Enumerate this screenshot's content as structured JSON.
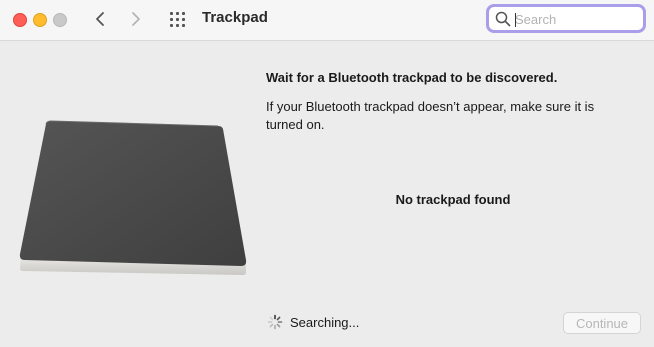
{
  "window": {
    "title": "Trackpad"
  },
  "toolbar": {
    "back_icon": "chevron-left-icon",
    "forward_icon": "chevron-right-icon",
    "grid_icon": "grid-icon"
  },
  "search": {
    "placeholder": "Search",
    "value": ""
  },
  "main": {
    "heading": "Wait for a Bluetooth trackpad to be discovered.",
    "description": "If your Bluetooth trackpad doesn’t appear, make sure it is turned on.",
    "status": "No trackpad found",
    "searching_label": "Searching...",
    "continue_label": "Continue"
  },
  "colors": {
    "close": "#ff5f57",
    "minimize": "#febc2e",
    "zoom_disabled": "#c9c9c9",
    "search_focus_ring": "#a99ee9",
    "trackpad_surface": "#4a4a4a"
  }
}
